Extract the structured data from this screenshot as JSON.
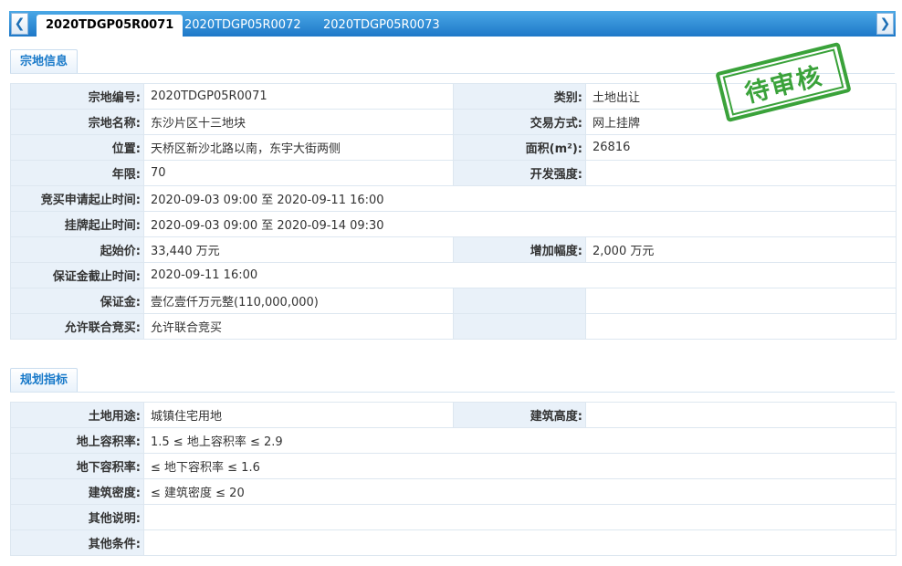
{
  "tabs": [
    {
      "label": "2020TDGP05R0071",
      "active": true
    },
    {
      "label": "2020TDGP05R0072",
      "active": false
    },
    {
      "label": "2020TDGP05R0073",
      "active": false
    }
  ],
  "nav": {
    "prev_icon": "chevron-left-icon",
    "next_icon": "chevron-right-icon"
  },
  "sections": {
    "parcel_info": "宗地信息",
    "planning": "规划指标"
  },
  "stamp": "待审核",
  "parcel": {
    "code_label": "宗地编号:",
    "code": "2020TDGP05R0071",
    "category_label": "类别:",
    "category": "土地出让",
    "name_label": "宗地名称:",
    "name": "东沙片区十三地块",
    "trade_label": "交易方式:",
    "trade": "网上挂牌",
    "location_label": "位置:",
    "location": "天桥区新沙北路以南，东宇大街两侧",
    "area_label": "面积(m²):",
    "area": "26816",
    "term_label": "年限:",
    "term": "70",
    "intensity_label": "开发强度:",
    "intensity": "",
    "bid_period_label": "竞买申请起止时间:",
    "bid_period": "2020-09-03 09:00 至 2020-09-11 16:00",
    "listing_period_label": "挂牌起止时间:",
    "listing_period": "2020-09-03 09:00 至 2020-09-14 09:30",
    "start_price_label": "起始价:",
    "start_price": "33,440 万元",
    "increment_label": "增加幅度:",
    "increment": "2,000 万元",
    "deposit_deadline_label": "保证金截止时间:",
    "deposit_deadline": "2020-09-11 16:00",
    "deposit_label": "保证金:",
    "deposit": "壹亿壹仟万元整(110,000,000)",
    "joint_label": "允许联合竞买:",
    "joint": "允许联合竞买"
  },
  "planning": {
    "use_label": "土地用途:",
    "use": "城镇住宅用地",
    "height_label": "建筑高度:",
    "height": "",
    "far_above_label": "地上容积率:",
    "far_above": "1.5 ≤ 地上容积率 ≤ 2.9",
    "far_below_label": "地下容积率:",
    "far_below": "≤ 地下容积率 ≤ 1.6",
    "density_label": "建筑密度:",
    "density": "≤ 建筑密度 ≤ 20",
    "other_note_label": "其他说明:",
    "other_note": "",
    "other_cond_label": "其他条件:",
    "other_cond": ""
  },
  "colors": {
    "accent": "#1879c9",
    "tab_bar": "#2a86d3",
    "label_bg": "#e9f1f9",
    "stamp": "#3aa23a"
  }
}
